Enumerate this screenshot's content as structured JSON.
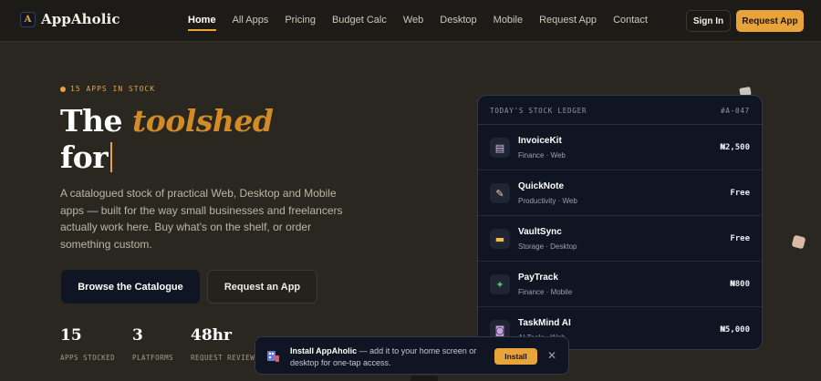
{
  "brand": {
    "logo_letter": "A",
    "name": "AppAholic"
  },
  "nav": {
    "links": [
      "Home",
      "All Apps",
      "Pricing",
      "Budget Calc",
      "Web",
      "Desktop",
      "Mobile",
      "Request App",
      "Contact"
    ],
    "active": "Home",
    "signin_label": "Sign In",
    "request_label": "Request App"
  },
  "hero": {
    "eyebrow": "15 APPS IN STOCK",
    "headline_line1_prefix": "The ",
    "headline_accent": "toolshed",
    "headline_line2": "for",
    "description": "A catalogued stock of practical Web, Desktop and Mobile apps — built for the way small businesses and freelancers actually work here. Buy what's on the shelf, or order something custom.",
    "browse_label": "Browse the Catalogue",
    "request_label": "Request an App"
  },
  "stats": [
    {
      "value": "15",
      "label": "APPS STOCKED"
    },
    {
      "value": "3",
      "label": "PLATFORMS"
    },
    {
      "value": "48hr",
      "label": "REQUEST REVIEW"
    }
  ],
  "ledger": {
    "title": "TODAY'S STOCK LEDGER",
    "id": "#A-047",
    "rows": [
      {
        "name": "InvoiceKit",
        "meta": "Finance · Web",
        "price": "₦2,500",
        "icon": "receipt-icon",
        "glyph": "▤",
        "glyph_color": "#d8c7e8"
      },
      {
        "name": "QuickNote",
        "meta": "Productivity · Web",
        "price": "Free",
        "icon": "notepad-icon",
        "glyph": "✎",
        "glyph_color": "#e7d6a6"
      },
      {
        "name": "VaultSync",
        "meta": "Storage · Desktop",
        "price": "Free",
        "icon": "folder-icon",
        "glyph": "▬",
        "glyph_color": "#f0c040"
      },
      {
        "name": "PayTrack",
        "meta": "Finance · Mobile",
        "price": "₦800",
        "icon": "money-icon",
        "glyph": "✦",
        "glyph_color": "#4cc36b"
      },
      {
        "name": "TaskMind AI",
        "meta": "AI Tools · Web",
        "price": "₦5,000",
        "icon": "robot-icon",
        "glyph": "◙",
        "glyph_color": "#c9a2e6"
      }
    ]
  },
  "toast": {
    "title": "Install AppAholic",
    "text": " — add it to your home screen or desktop for one-tap access.",
    "install_label": "Install",
    "close_glyph": "✕"
  },
  "colors": {
    "accent": "#e8a33a",
    "navy": "#0f1522",
    "background": "#2a2721"
  }
}
